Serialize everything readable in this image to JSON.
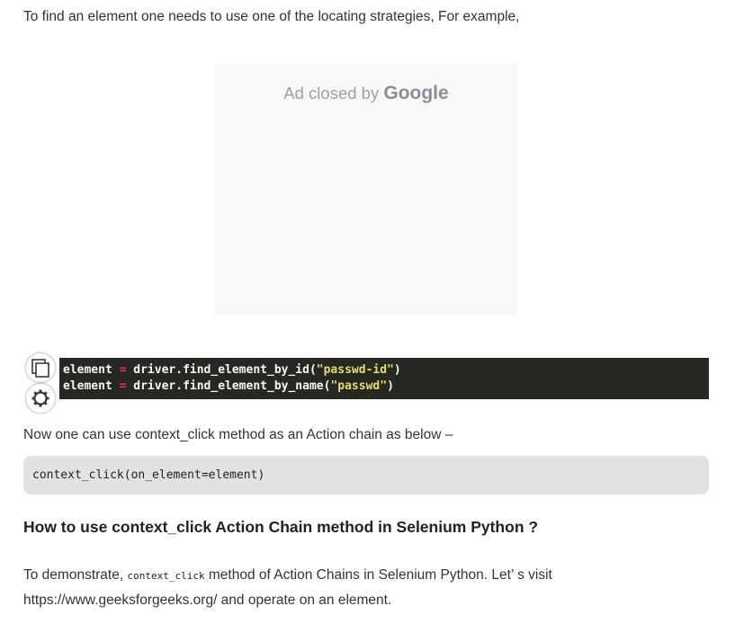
{
  "intro_text": "To find an element one needs to use one of the locating strategies, For example,",
  "ad": {
    "closed_text": "Ad closed by",
    "brand": "Google"
  },
  "code_block": {
    "line1": {
      "var": "element",
      "op": "=",
      "call": "driver.find_element_by_id(",
      "arg": "\"passwd-id\"",
      "close": ")"
    },
    "line2": {
      "var": "element",
      "op": "=",
      "call": "driver.find_element_by_name(",
      "arg": "\"passwd\"",
      "close": ")"
    }
  },
  "toolbar_icons": {
    "copy": "copy-icon",
    "settings": "gear-icon"
  },
  "now_text": "Now one can use context_click method as an Action chain as below –",
  "snippet": "context_click(on_element=element)",
  "heading": "How to use context_click Action Chain method in Selenium Python ?",
  "demo": {
    "prefix": "To demonstrate,",
    "inline_code": "context_click",
    "suffix": "method of Action Chains in Selenium Python. Let’ s visit https://www.geeksforgeeks.org/ and operate on an element."
  },
  "colors": {
    "code_bg": "#272822",
    "code_operator": "#f92672",
    "code_string": "#e6db74",
    "snippet_bg": "#e2e2e2",
    "ad_bg": "#f8f8f8"
  }
}
